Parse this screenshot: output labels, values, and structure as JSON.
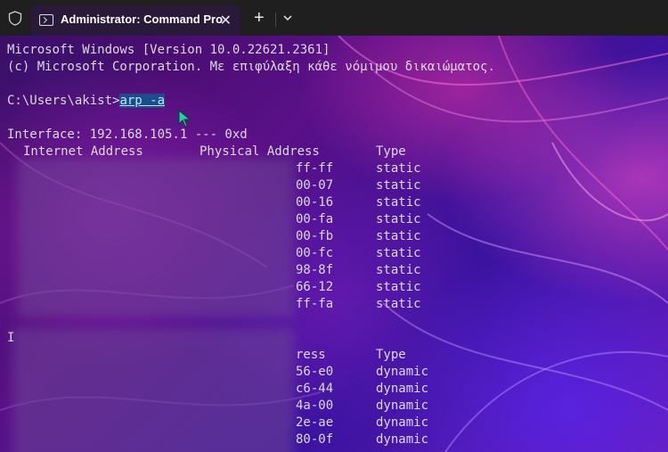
{
  "window": {
    "tab_title": "Administrator: Command Pro",
    "tab_close": "✕",
    "new_tab": "+",
    "dropdown": "dropdown"
  },
  "colors": {
    "titlebar": "#1f1f1f",
    "tab": "#2a1a3a",
    "text": "#dadada",
    "selection": "#1a4d8a"
  },
  "terminal": {
    "line1": "Microsoft Windows [Version 10.0.22621.2361]",
    "line2": "(c) Microsoft Corporation. Με επιφύλαξη κάθε νόμιμου δικαιώματος.",
    "prompt": "C:\\Users\\akist>",
    "command": "arp -a",
    "interface1": "Interface: 192.168.105.1 --- 0xd",
    "headers": {
      "internet": "Internet Address",
      "physical": "Physical Address",
      "type": "Type"
    },
    "table1": [
      {
        "mac_tail": "ff-ff",
        "type": "static"
      },
      {
        "mac_tail": "00-07",
        "type": "static"
      },
      {
        "mac_tail": "00-16",
        "type": "static"
      },
      {
        "mac_tail": "00-fa",
        "type": "static"
      },
      {
        "mac_tail": "00-fb",
        "type": "static"
      },
      {
        "mac_tail": "00-fc",
        "type": "static"
      },
      {
        "mac_tail": "98-8f",
        "type": "static"
      },
      {
        "mac_tail": "66-12",
        "type": "static"
      },
      {
        "mac_tail": "ff-fa",
        "type": "static"
      }
    ],
    "interface2_prefix": "I",
    "headers2": {
      "physical_tail": "ress",
      "type": "Type"
    },
    "table2": [
      {
        "mac_tail": "56-e0",
        "type": "dynamic"
      },
      {
        "mac_tail": "c6-44",
        "type": "dynamic"
      },
      {
        "mac_tail": "4a-00",
        "type": "dynamic"
      },
      {
        "mac_tail": "2e-ae",
        "type": "dynamic"
      },
      {
        "mac_tail": "80-0f",
        "type": "dynamic"
      }
    ]
  }
}
